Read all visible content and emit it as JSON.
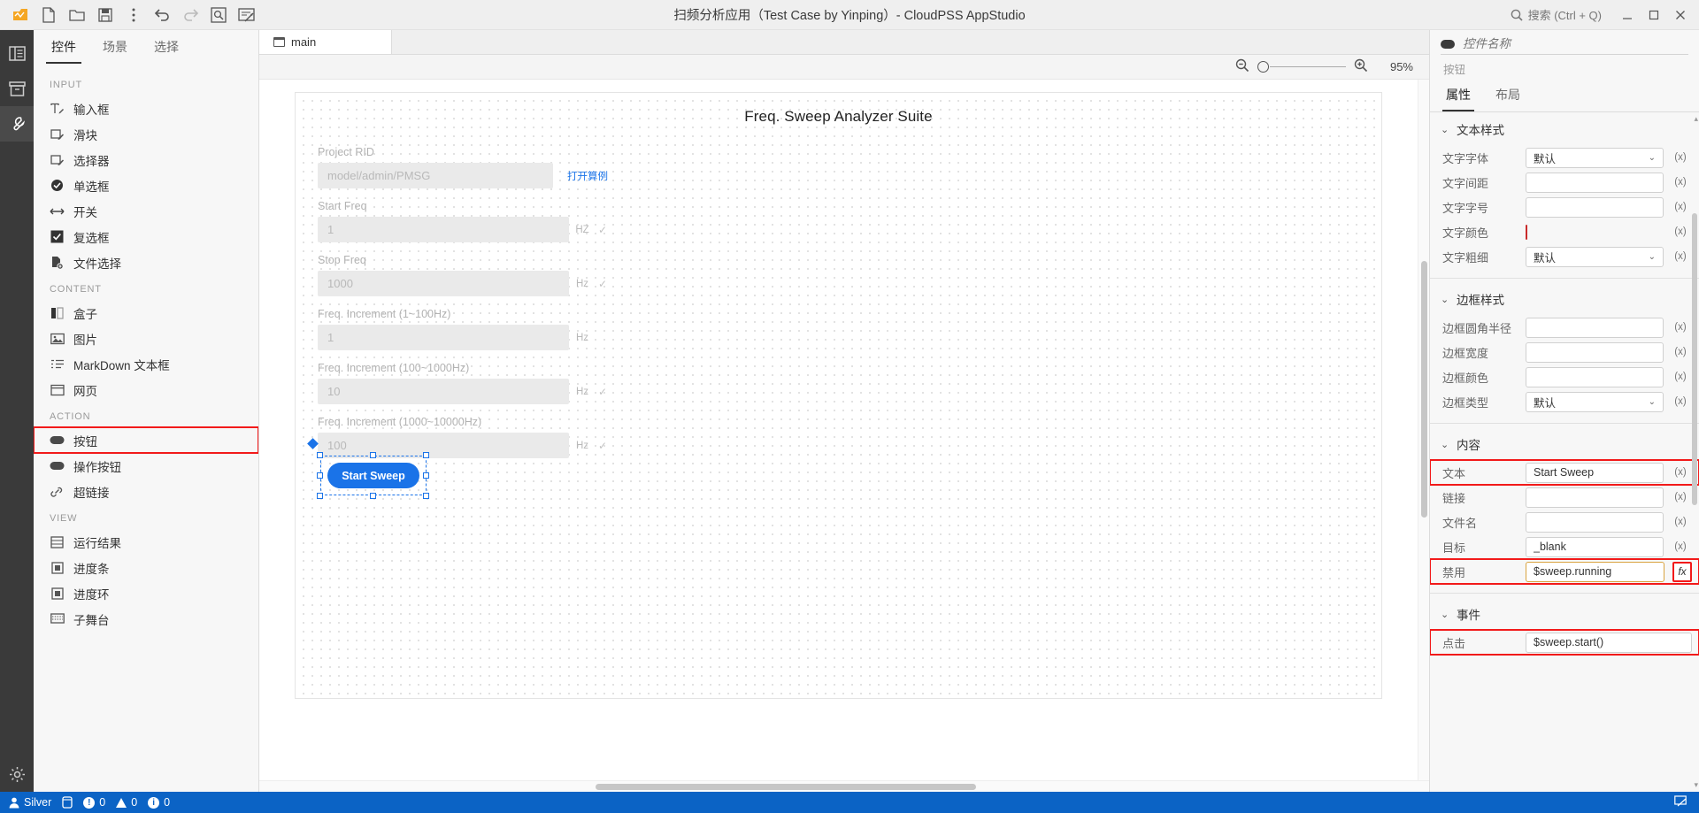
{
  "titlebar": {
    "title": "扫频分析应用（Test Case by Yinping）- CloudPSS AppStudio",
    "tools": [
      {
        "name": "app-logo-icon",
        "label": "CloudPSS"
      },
      {
        "name": "new-file-icon",
        "label": "新建"
      },
      {
        "name": "open-folder-icon",
        "label": "打开"
      },
      {
        "name": "save-icon",
        "label": "保存"
      },
      {
        "name": "more-options-icon",
        "label": "更多"
      },
      {
        "name": "undo-icon",
        "label": "撤销"
      },
      {
        "name": "redo-icon",
        "label": "重做"
      },
      {
        "name": "preview-icon",
        "label": "预览"
      },
      {
        "name": "publish-icon",
        "label": "发布"
      }
    ],
    "search_placeholder": "搜索 (Ctrl + Q)",
    "window_buttons": [
      "minimize",
      "maximize",
      "close"
    ]
  },
  "rail": {
    "items": [
      {
        "name": "explorer",
        "icon": "panel-icon"
      },
      {
        "name": "resources",
        "icon": "archive-icon"
      },
      {
        "name": "tools",
        "icon": "wrench-icon"
      },
      {
        "name": "settings",
        "icon": "gear-icon"
      }
    ]
  },
  "left_panel": {
    "tabs": [
      {
        "label": "控件",
        "active": true
      },
      {
        "label": "场景",
        "active": false
      },
      {
        "label": "选择",
        "active": false
      }
    ],
    "groups": [
      {
        "title": "INPUT",
        "items": [
          {
            "label": "输入框",
            "icon": "textbox-icon"
          },
          {
            "label": "滑块",
            "icon": "slider-icon"
          },
          {
            "label": "选择器",
            "icon": "picker-icon"
          },
          {
            "label": "单选框",
            "icon": "radio-icon"
          },
          {
            "label": "开关",
            "icon": "switch-icon"
          },
          {
            "label": "复选框",
            "icon": "checkbox-icon"
          },
          {
            "label": "文件选择",
            "icon": "file-select-icon"
          }
        ]
      },
      {
        "title": "CONTENT",
        "items": [
          {
            "label": "盒子",
            "icon": "box-icon"
          },
          {
            "label": "图片",
            "icon": "image-icon"
          },
          {
            "label": "MarkDown 文本框",
            "icon": "markdown-icon"
          },
          {
            "label": "网页",
            "icon": "webpage-icon"
          }
        ]
      },
      {
        "title": "ACTION",
        "items": [
          {
            "label": "按钮",
            "icon": "button-icon",
            "highlighted": true
          },
          {
            "label": "操作按钮",
            "icon": "action-button-icon"
          },
          {
            "label": "超链接",
            "icon": "link-icon"
          }
        ]
      },
      {
        "title": "VIEW",
        "items": [
          {
            "label": "运行结果",
            "icon": "result-icon"
          },
          {
            "label": "进度条",
            "icon": "progress-bar-icon"
          },
          {
            "label": "进度环",
            "icon": "progress-ring-icon"
          },
          {
            "label": "子舞台",
            "icon": "substage-icon"
          }
        ]
      }
    ]
  },
  "center": {
    "tab": {
      "label": "main",
      "icon": "page-icon"
    },
    "zoom": {
      "value": "95%",
      "out_icon": "zoom-out-icon",
      "in_icon": "zoom-in-icon"
    },
    "stage": {
      "title": "Freq. Sweep Analyzer Suite",
      "fields": [
        {
          "label": "Project RID",
          "value": "model/admin/PMSG",
          "unit": "",
          "check": false,
          "link": "打开算例"
        },
        {
          "label": "Start Freq",
          "value": "1",
          "unit": "HZ",
          "check": true
        },
        {
          "label": "Stop Freq",
          "value": "1000",
          "unit": "Hz",
          "check": true
        },
        {
          "label": "Freq. Increment (1~100Hz)",
          "value": "1",
          "unit": "Hz",
          "check": false
        },
        {
          "label": "Freq. Increment (100~1000Hz)",
          "value": "10",
          "unit": "Hz",
          "check": true
        },
        {
          "label": "Freq. Increment (1000~10000Hz)",
          "value": "100",
          "unit": "Hz",
          "check": true
        }
      ],
      "selected_button": {
        "label": "Start Sweep"
      }
    }
  },
  "right_panel": {
    "widget_name_placeholder": "控件名称",
    "widget_type": "按钮",
    "tabs": [
      {
        "label": "属性",
        "active": true
      },
      {
        "label": "布局",
        "active": false
      }
    ],
    "sections": [
      {
        "title": "文本样式",
        "rows": [
          {
            "label": "文字字体",
            "type": "select",
            "value": "默认",
            "fx": "(x)"
          },
          {
            "label": "文字间距",
            "type": "input",
            "value": "",
            "fx": "(x)"
          },
          {
            "label": "文字字号",
            "type": "input",
            "value": "",
            "fx": "(x)"
          },
          {
            "label": "文字颜色",
            "type": "color",
            "value": "",
            "fx": "(x)"
          },
          {
            "label": "文字粗细",
            "type": "select",
            "value": "默认",
            "fx": "(x)"
          }
        ]
      },
      {
        "title": "边框样式",
        "rows": [
          {
            "label": "边框圆角半径",
            "type": "input",
            "value": "",
            "fx": "(x)"
          },
          {
            "label": "边框宽度",
            "type": "input",
            "value": "",
            "fx": "(x)"
          },
          {
            "label": "边框颜色",
            "type": "input",
            "value": "",
            "fx": "(x)"
          },
          {
            "label": "边框类型",
            "type": "select",
            "value": "默认",
            "fx": "(x)"
          }
        ]
      },
      {
        "title": "内容",
        "rows": [
          {
            "label": "文本",
            "type": "input",
            "value": "Start Sweep",
            "fx": "(x)",
            "highlight": true
          },
          {
            "label": "链接",
            "type": "input",
            "value": "",
            "fx": "(x)"
          },
          {
            "label": "文件名",
            "type": "input",
            "value": "",
            "fx": "(x)"
          },
          {
            "label": "目标",
            "type": "input",
            "value": "_blank",
            "fx": "(x)"
          },
          {
            "label": "禁用",
            "type": "input",
            "value": "$sweep.running",
            "fx": "fx",
            "highlight": true,
            "warn": true,
            "fx_highlight": true
          }
        ]
      },
      {
        "title": "事件",
        "rows": [
          {
            "label": "点击",
            "type": "input",
            "value": "$sweep.start()",
            "fx": "",
            "highlight": true
          }
        ]
      }
    ]
  },
  "statusbar": {
    "user": "Silver",
    "db_icon": "database-icon",
    "counts": [
      {
        "icon": "error-icon",
        "value": "0"
      },
      {
        "icon": "warning-icon",
        "value": "0"
      },
      {
        "icon": "info-icon",
        "value": "0"
      }
    ],
    "accent_color": "#0b63c5"
  },
  "colors": {
    "highlight_red": "#f21a1a",
    "accent_blue": "#1a73e8",
    "status_blue": "#0b63c5",
    "link_blue": "#1a73e8"
  }
}
